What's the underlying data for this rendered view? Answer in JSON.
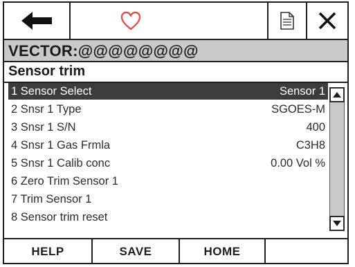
{
  "toolbar": {
    "back_icon": "left-arrow-icon",
    "favorite_icon": "heart-outline-icon",
    "favorite_color": "#d9534f",
    "document_icon": "document-icon",
    "close_icon": "close-x-icon"
  },
  "device": {
    "title": "VECTOR:@@@@@@@@"
  },
  "menu": {
    "title": "Sensor trim"
  },
  "items": [
    {
      "label": "1 Sensor Select",
      "value": "Sensor 1"
    },
    {
      "label": "2 Snsr 1 Type",
      "value": "SGOES-M"
    },
    {
      "label": "3 Snsr 1 S/N",
      "value": "400"
    },
    {
      "label": "4 Snsr 1 Gas Frmla",
      "value": "C3H8"
    },
    {
      "label": "5 Snsr 1 Calib conc",
      "value": "0.00 Vol %"
    },
    {
      "label": "6 Zero Trim Sensor 1",
      "value": ""
    },
    {
      "label": "7 Trim Sensor 1",
      "value": ""
    },
    {
      "label": "8 Sensor trim reset",
      "value": ""
    }
  ],
  "selected_index": 0,
  "function_keys": {
    "f1": "HELP",
    "f2": "SAVE",
    "f3": "HOME",
    "f4": ""
  },
  "colors": {
    "selected_row": "#3c3c3c",
    "title_bar": "#c9c9c9"
  }
}
